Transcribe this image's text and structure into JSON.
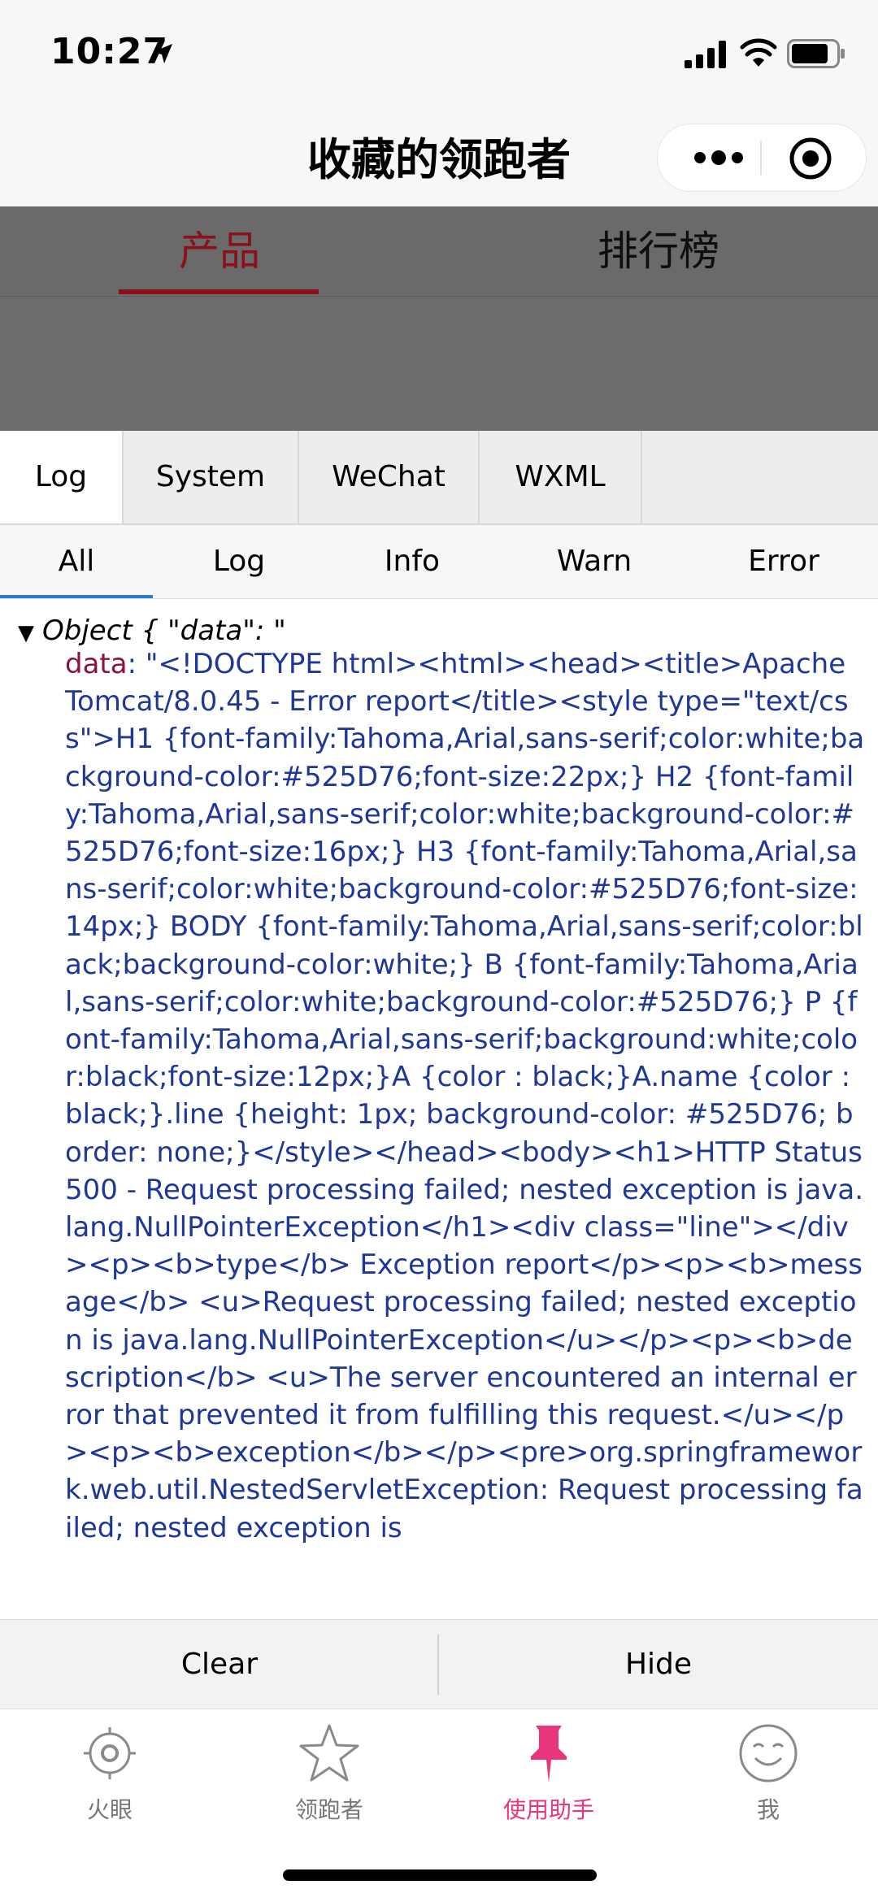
{
  "status_bar": {
    "time": "10:27"
  },
  "nav": {
    "title": "收藏的领跑者"
  },
  "page_tabs": {
    "active": "产品",
    "other": "排行榜"
  },
  "vconsole": {
    "tabs": [
      "Log",
      "System",
      "WeChat",
      "WXML"
    ],
    "filters": [
      "All",
      "Log",
      "Info",
      "Warn",
      "Error"
    ],
    "object_header": "Object { \"data\": \"",
    "data_key": "data",
    "data_value": ": \"<!DOCTYPE html><html><head><title>Apache Tomcat/8.0.45 - Error report</title><style type=\"text/css\">H1 {font-family:Tahoma,Arial,sans-serif;color:white;background-color:#525D76;font-size:22px;} H2 {font-family:Tahoma,Arial,sans-serif;color:white;background-color:#525D76;font-size:16px;} H3 {font-family:Tahoma,Arial,sans-serif;color:white;background-color:#525D76;font-size:14px;} BODY {font-family:Tahoma,Arial,sans-serif;color:black;background-color:white;} B {font-family:Tahoma,Arial,sans-serif;color:white;background-color:#525D76;} P {font-family:Tahoma,Arial,sans-serif;background:white;color:black;font-size:12px;}A {color : black;}A.name {color : black;}.line {height: 1px; background-color: #525D76; border: none;}</style></head><body><h1>HTTP Status 500 - Request processing failed; nested exception is java.lang.NullPointerException</h1><div class=\"line\"></div><p><b>type</b> Exception report</p><p><b>message</b> <u>Request processing failed; nested exception is java.lang.NullPointerException</u></p><p><b>description</b> <u>The server encountered an internal error that prevented it from fulfilling this request.</u></p><p><b>exception</b></p><pre>org.springframework.web.util.NestedServletException: Request processing failed; nested exception is",
    "buttons": {
      "clear": "Clear",
      "hide": "Hide"
    }
  },
  "tabbar": {
    "items": [
      {
        "label": "火眼",
        "icon": "target-icon"
      },
      {
        "label": "领跑者",
        "icon": "star-icon"
      },
      {
        "label": "使用助手",
        "icon": "pin-icon"
      },
      {
        "label": "我",
        "icon": "smile-icon"
      }
    ],
    "active_color": "#e8357c"
  }
}
